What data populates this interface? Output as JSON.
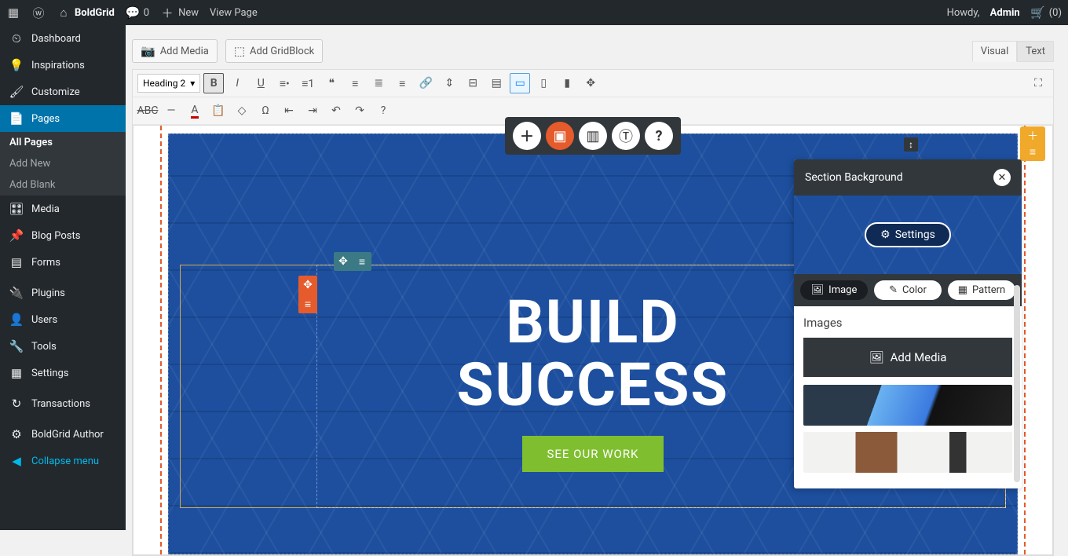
{
  "adminbar": {
    "site_name": "BoldGrid",
    "comments_count": "0",
    "new_label": "New",
    "view_page": "View Page",
    "howdy": "Howdy,",
    "user": "Admin",
    "cart_count": "(0)"
  },
  "sidebar": {
    "items": [
      {
        "icon": "dashboard",
        "label": "Dashboard"
      },
      {
        "icon": "lightbulb",
        "label": "Inspirations"
      },
      {
        "icon": "brush",
        "label": "Customize"
      },
      {
        "icon": "pages",
        "label": "Pages",
        "active": true,
        "sub": [
          {
            "label": "All Pages",
            "current": true
          },
          {
            "label": "Add New"
          },
          {
            "label": "Add Blank"
          }
        ]
      },
      {
        "icon": "media",
        "label": "Media"
      },
      {
        "icon": "pin",
        "label": "Blog Posts"
      },
      {
        "icon": "form",
        "label": "Forms"
      },
      {
        "sep": true
      },
      {
        "icon": "plug",
        "label": "Plugins"
      },
      {
        "icon": "user",
        "label": "Users"
      },
      {
        "icon": "wrench",
        "label": "Tools"
      },
      {
        "icon": "settings",
        "label": "Settings"
      },
      {
        "sep": true
      },
      {
        "icon": "refresh",
        "label": "Transactions"
      },
      {
        "sep": true
      },
      {
        "icon": "gear",
        "label": "BoldGrid Author"
      },
      {
        "icon": "collapse",
        "label": "Collapse menu",
        "collapse": true
      }
    ]
  },
  "editor": {
    "add_media": "Add Media",
    "add_gridblock": "Add GridBlock",
    "tabs": {
      "visual": "Visual",
      "text": "Text"
    },
    "format_dropdown": "Heading 2"
  },
  "hero": {
    "headline_l1": "BUILD",
    "headline_l2": "SUCCESS",
    "cta": "SEE OUR WORK"
  },
  "popover": {
    "title": "Section Background",
    "settings": "Settings",
    "tabs": {
      "image": "Image",
      "color": "Color",
      "pattern": "Pattern"
    },
    "section_label": "Images",
    "add_media": "Add Media"
  }
}
